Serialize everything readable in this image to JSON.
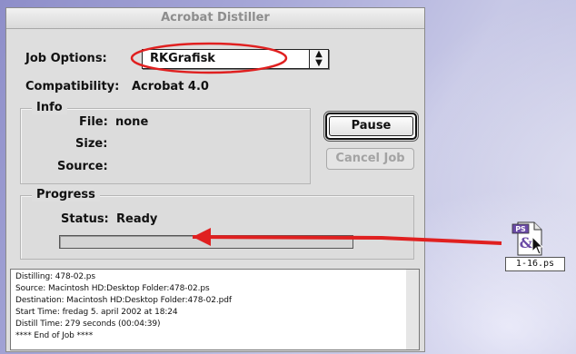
{
  "window": {
    "title": "Acrobat Distiller",
    "job_options_label": "Job Options:",
    "job_options_value": "RKGrafisk",
    "compatibility_label": "Compatibility:",
    "compatibility_value": "Acrobat 4.0"
  },
  "info": {
    "title": "Info",
    "file_label": "File:",
    "file_value": "none",
    "size_label": "Size:",
    "source_label": "Source:"
  },
  "buttons": {
    "pause": "Pause",
    "cancel": "Cancel Job"
  },
  "progress": {
    "title": "Progress",
    "status_label": "Status:",
    "status_value": "Ready",
    "fraction": 0
  },
  "log": [
    "Distilling: 478-02.ps",
    "Source: Macintosh HD:Desktop Folder:478-02.ps",
    "Destination: Macintosh HD:Desktop Folder:478-02.pdf",
    "Start Time: fredag 5. april 2002 at 18:24",
    "Distill Time: 279 seconds (00:04:39)",
    "**** End of Job ****"
  ],
  "desktop": {
    "file_name": "1-16.ps",
    "file_icon_badge": "PS",
    "icon": "postscript-file-icon"
  },
  "annotation_color": "#e02020"
}
